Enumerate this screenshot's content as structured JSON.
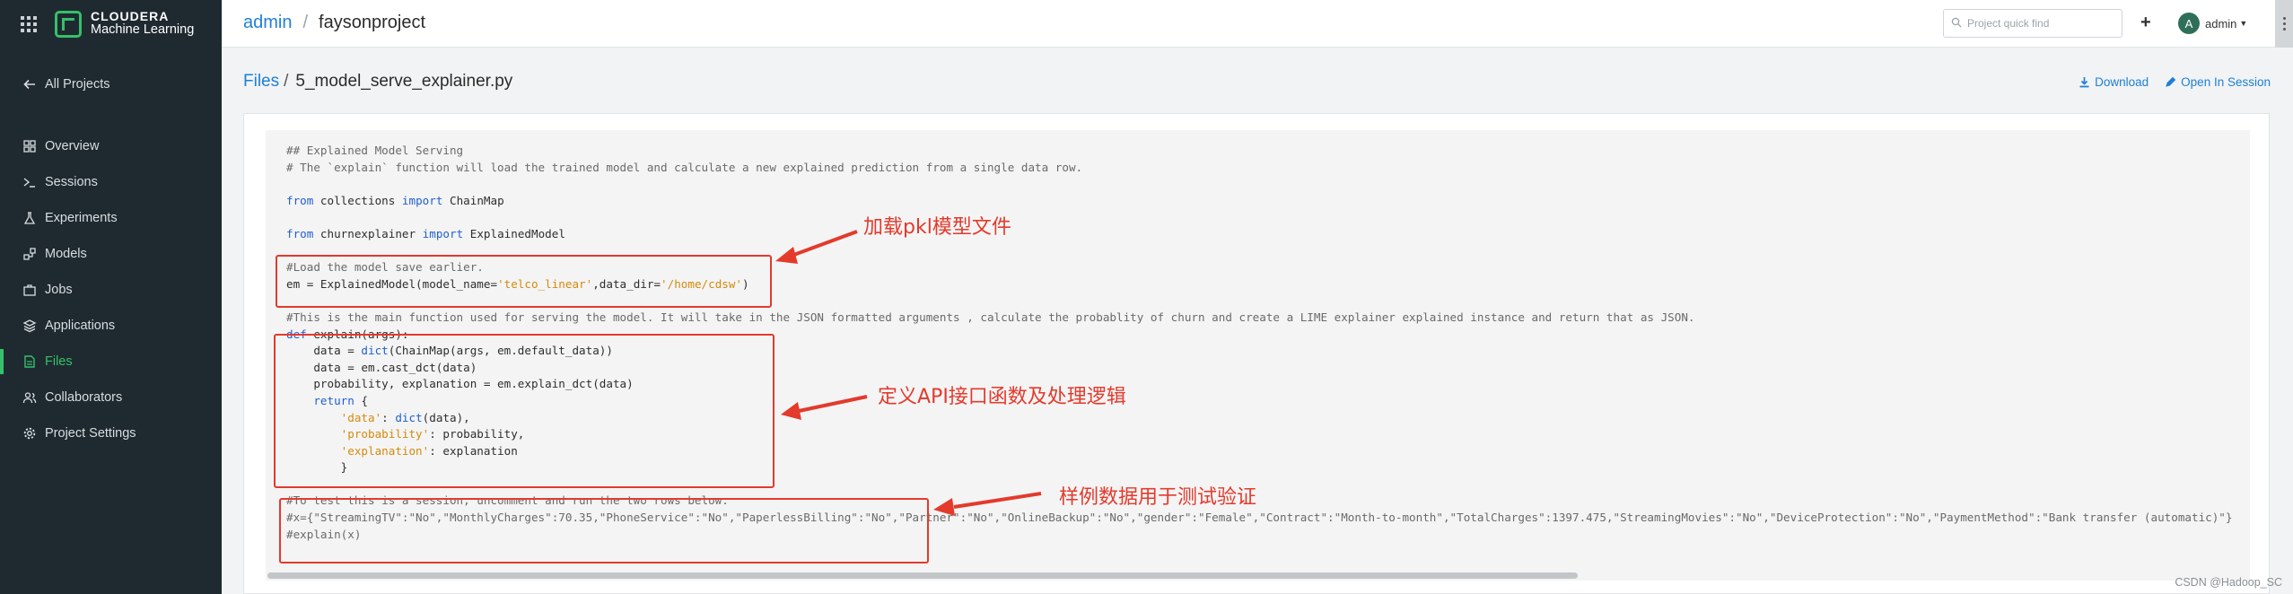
{
  "brand": {
    "line1": "CLOUDERA",
    "line2": "Machine Learning"
  },
  "sidebar": {
    "back_label": "All Projects",
    "items": [
      {
        "label": "Overview",
        "icon": "overview-icon"
      },
      {
        "label": "Sessions",
        "icon": "terminal-icon"
      },
      {
        "label": "Experiments",
        "icon": "flask-icon"
      },
      {
        "label": "Models",
        "icon": "models-icon"
      },
      {
        "label": "Jobs",
        "icon": "briefcase-icon"
      },
      {
        "label": "Applications",
        "icon": "layers-icon"
      },
      {
        "label": "Files",
        "icon": "file-icon",
        "active": true
      },
      {
        "label": "Collaborators",
        "icon": "users-icon"
      },
      {
        "label": "Project Settings",
        "icon": "gear-icon"
      }
    ]
  },
  "topbar": {
    "crumb_user": "admin",
    "crumb_sep": "/",
    "crumb_project": "faysonproject",
    "search_placeholder": "Project quick find",
    "plus": "+",
    "avatar_letter": "A",
    "user_name": "admin"
  },
  "page": {
    "crumb_files": "Files",
    "crumb_sep": "/",
    "file_name": "5_model_serve_explainer.py",
    "download_label": "Download",
    "open_session_label": "Open In Session"
  },
  "code": [
    [
      [
        "cm",
        "## Explained Model Serving"
      ]
    ],
    [
      [
        "cm",
        "# The `explain` function will load the trained model and calculate a new explained prediction from a single data row."
      ]
    ],
    [],
    [
      [
        "kw",
        "from"
      ],
      [
        "",
        " collections "
      ],
      [
        "kw",
        "import"
      ],
      [
        "",
        " ChainMap"
      ]
    ],
    [],
    [
      [
        "kw",
        "from"
      ],
      [
        "",
        " churnexplainer "
      ],
      [
        "kw",
        "import"
      ],
      [
        "",
        " ExplainedModel"
      ]
    ],
    [],
    [
      [
        "cm",
        "#Load the model save earlier."
      ]
    ],
    [
      [
        "",
        "em = ExplainedModel(model_name="
      ],
      [
        "st",
        "'telco_linear'"
      ],
      [
        "",
        ",data_dir="
      ],
      [
        "st",
        "'/home/cdsw'"
      ],
      [
        "",
        ")"
      ]
    ],
    [],
    [
      [
        "cm",
        "#This is the main function used for serving the model. It will take in the JSON formatted arguments , calculate the probablity of churn and create a LIME explainer explained instance and return that as JSON."
      ]
    ],
    [
      [
        "kw",
        "def"
      ],
      [
        "",
        " explain(args):"
      ]
    ],
    [
      [
        "",
        "    data = "
      ],
      [
        "kw",
        "dict"
      ],
      [
        "",
        "(ChainMap(args, em.default_data))"
      ]
    ],
    [
      [
        "",
        "    data = em.cast_dct(data)"
      ]
    ],
    [
      [
        "",
        "    probability, explanation = em.explain_dct(data)"
      ]
    ],
    [
      [
        "kw",
        "    return"
      ],
      [
        "",
        " {"
      ]
    ],
    [
      [
        "st",
        "        'data'"
      ],
      [
        "",
        ": "
      ],
      [
        "kw",
        "dict"
      ],
      [
        "",
        "(data),"
      ]
    ],
    [
      [
        "st",
        "        'probability'"
      ],
      [
        "",
        ": probability,"
      ]
    ],
    [
      [
        "st",
        "        'explanation'"
      ],
      [
        "",
        ": explanation"
      ]
    ],
    [
      [
        "",
        "        }"
      ]
    ],
    [],
    [
      [
        "cm",
        "#To test this is a session, uncomment and run the two rows below."
      ]
    ],
    [
      [
        "cm",
        "#x={\"StreamingTV\":\"No\",\"MonthlyCharges\":70.35,\"PhoneService\":\"No\",\"PaperlessBilling\":\"No\",\"Partner\":\"No\",\"OnlineBackup\":\"No\",\"gender\":\"Female\",\"Contract\":\"Month-to-month\",\"TotalCharges\":1397.475,\"StreamingMovies\":\"No\",\"DeviceProtection\":\"No\",\"PaymentMethod\":\"Bank transfer (automatic)\"}"
      ]
    ],
    [
      [
        "cm",
        "#explain(x)"
      ]
    ]
  ],
  "annotations": {
    "load_model": "加载pkl模型文件",
    "define_api": "定义API接口函数及处理逻辑",
    "sample_data": "样例数据用于测试验证",
    "color": "#e33a2c"
  },
  "watermark": "CSDN @Hadoop_SC"
}
